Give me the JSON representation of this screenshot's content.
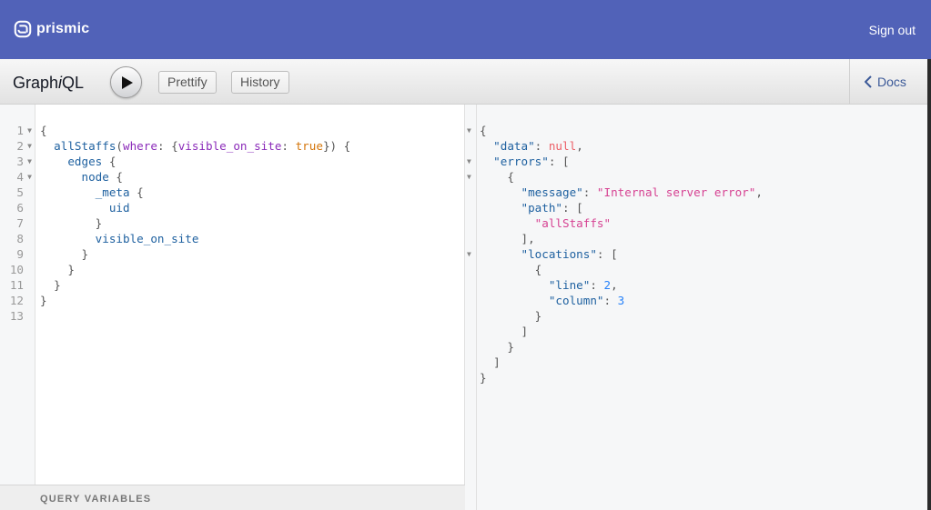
{
  "topbar": {
    "logo_text": "prismic",
    "signout_label": "Sign out"
  },
  "toolbar": {
    "title_pre": "Graph",
    "title_i": "i",
    "title_post": "QL",
    "prettify_label": "Prettify",
    "history_label": "History",
    "docs_label": "Docs"
  },
  "query_editor": {
    "line_numbers": [
      "1",
      "2",
      "3",
      "4",
      "5",
      "6",
      "7",
      "8",
      "9",
      "10",
      "11",
      "12",
      "13"
    ],
    "lines": [
      "{",
      "  allStaffs(where: {visible_on_site: true}) {",
      "    edges {",
      "      node {",
      "        _meta {",
      "          uid",
      "        }",
      "        visible_on_site",
      "      }",
      "    }",
      "  }",
      "}",
      ""
    ]
  },
  "query_variables": {
    "label": "QUERY VARIABLES"
  },
  "result": {
    "lines": [
      "{",
      "  \"data\": null,",
      "  \"errors\": [",
      "    {",
      "      \"message\": \"Internal server error\",",
      "      \"path\": [",
      "        \"allStaffs\"",
      "      ],",
      "      \"locations\": [",
      "        {",
      "          \"line\": 2,",
      "          \"column\": 3",
      "        }",
      "      ]",
      "    }",
      "  ]",
      "}"
    ]
  },
  "colors": {
    "header": "#5162b8",
    "link": "#3b5998",
    "string": "#d64292",
    "number": "#2882f9"
  }
}
